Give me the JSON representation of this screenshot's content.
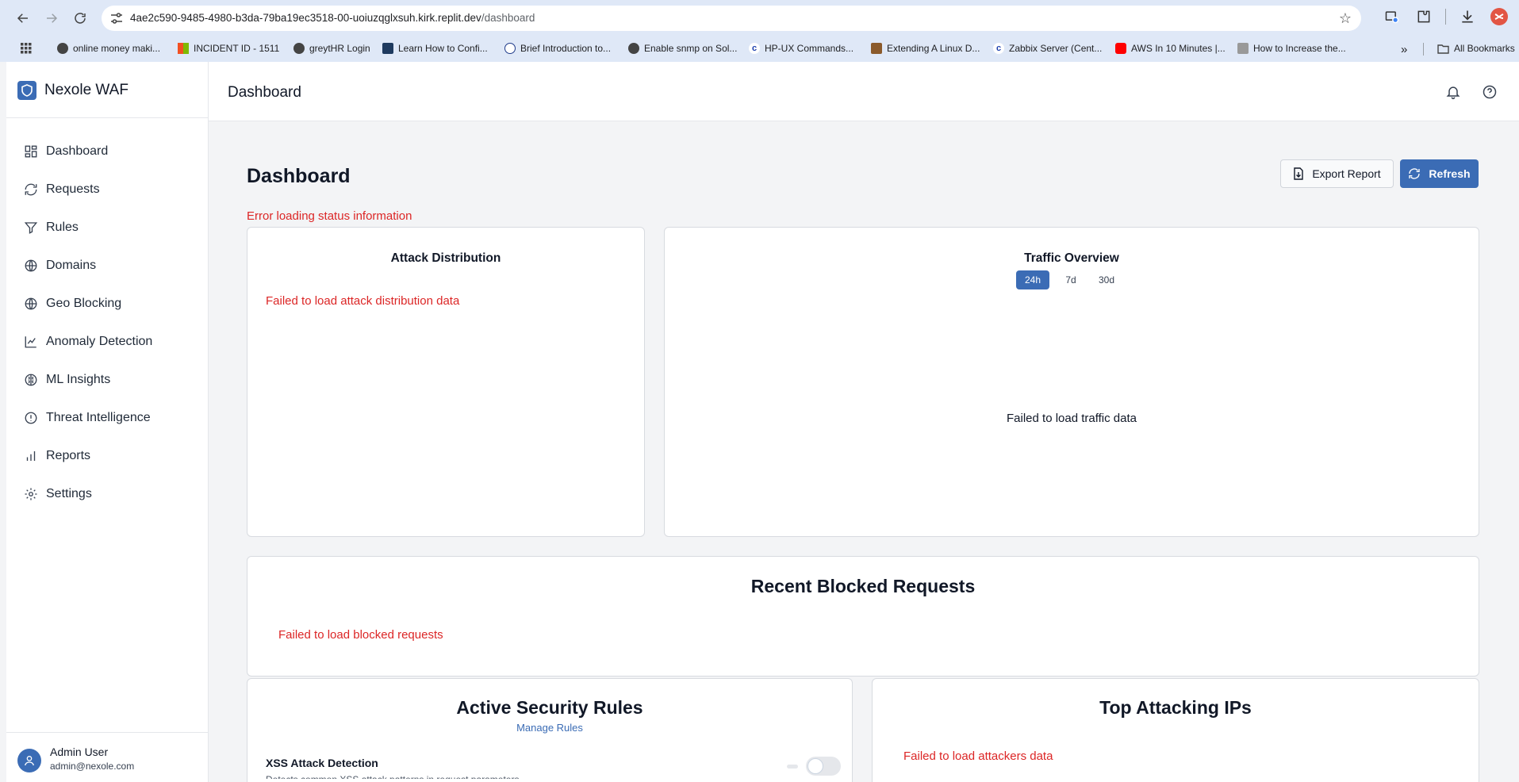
{
  "browser": {
    "url_host": "4ae2c590-9485-4980-b3da-79ba19ec3518-00-uoiuzqglxsuh.kirk.replit.dev",
    "url_path": "/dashboard",
    "bookmarks": [
      "online money maki...",
      "INCIDENT ID - 1511",
      "greytHR Login",
      "Learn How to Confi...",
      "Brief Introduction to...",
      "Enable snmp on Sol...",
      "HP-UX Commands...",
      "Extending A Linux D...",
      "Zabbix Server (Cent...",
      "AWS In 10 Minutes |...",
      "How to Increase the..."
    ],
    "more_bookmarks": "»",
    "all_bookmarks": "All Bookmarks"
  },
  "sidebar": {
    "brand": "Nexole WAF",
    "items": [
      {
        "label": "Dashboard",
        "icon": "dashboard-icon"
      },
      {
        "label": "Requests",
        "icon": "refresh-icon"
      },
      {
        "label": "Rules",
        "icon": "filter-icon"
      },
      {
        "label": "Domains",
        "icon": "globe-icon"
      },
      {
        "label": "Geo Blocking",
        "icon": "globe-icon"
      },
      {
        "label": "Anomaly Detection",
        "icon": "line-chart-icon"
      },
      {
        "label": "ML Insights",
        "icon": "brain-icon"
      },
      {
        "label": "Threat Intelligence",
        "icon": "alert-circle-icon"
      },
      {
        "label": "Reports",
        "icon": "bar-chart-icon"
      },
      {
        "label": "Settings",
        "icon": "gear-icon"
      }
    ],
    "user": {
      "name": "Admin User",
      "email": "admin@nexole.com"
    }
  },
  "topbar": {
    "title": "Dashboard"
  },
  "main": {
    "title": "Dashboard",
    "export_label": "Export Report",
    "refresh_label": "Refresh",
    "status_error": "Error loading status information",
    "attack_distribution": {
      "title": "Attack Distribution",
      "error": "Failed to load attack distribution data"
    },
    "traffic_overview": {
      "title": "Traffic Overview",
      "ranges": [
        "24h",
        "7d",
        "30d"
      ],
      "selected_range": "24h",
      "error": "Failed to load traffic data"
    },
    "recent_blocked": {
      "title": "Recent Blocked Requests",
      "error": "Failed to load blocked requests"
    },
    "active_rules": {
      "title": "Active Security Rules",
      "manage_link": "Manage Rules",
      "rule_name": "XSS Attack Detection",
      "rule_desc": "Detects common XSS attack patterns in request parameters"
    },
    "top_ips": {
      "title": "Top Attacking IPs",
      "error": "Failed to load attackers data"
    }
  },
  "colors": {
    "accent": "#3b6cb5",
    "error": "#dc2626"
  }
}
